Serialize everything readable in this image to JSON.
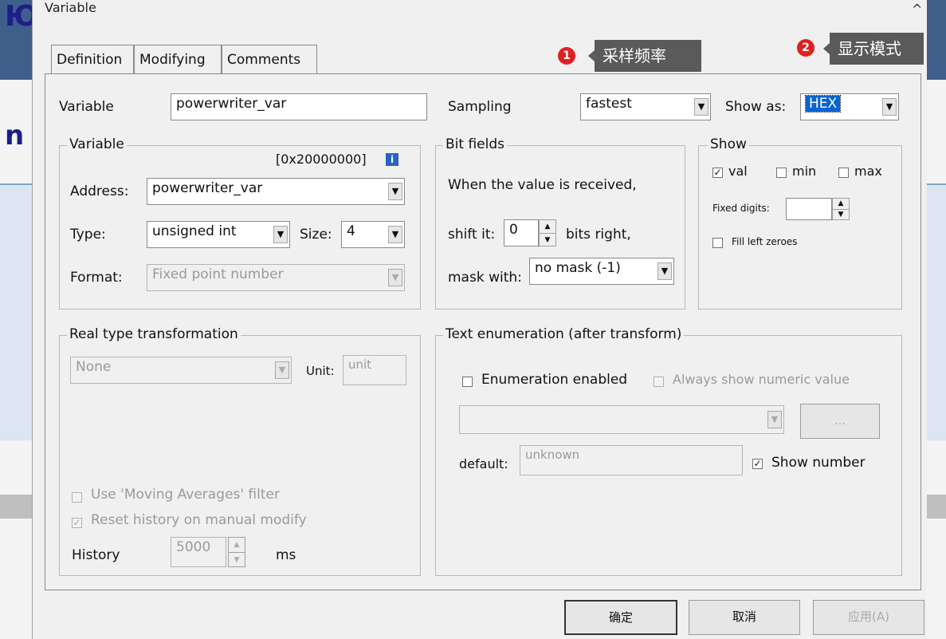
{
  "window": {
    "title": "Variable",
    "close_glyph": "^"
  },
  "tabs": [
    {
      "label": "Definition"
    },
    {
      "label": "Modifying"
    },
    {
      "label": "Comments"
    }
  ],
  "callouts": [
    {
      "badge": "1",
      "text": "采样频率"
    },
    {
      "badge": "2",
      "text": "显示模式"
    }
  ],
  "header": {
    "variable_label": "Variable",
    "variable_value": "powerwriter_var",
    "sampling_label": "Sampling",
    "sampling_value": "fastest",
    "show_as_label": "Show as:",
    "show_as_value": "HEX"
  },
  "variable_group": {
    "title": "Variable",
    "address_hex": "[0x20000000]",
    "info_glyph": "i",
    "address_label": "Address:",
    "address_value": "powerwriter_var",
    "type_label": "Type:",
    "type_value": "unsigned int",
    "size_label": "Size:",
    "size_value": "4",
    "format_label": "Format:",
    "format_value": "Fixed point number"
  },
  "bit_fields": {
    "title": "Bit fields",
    "when_text": "When the value is received,",
    "shift_label": "shift it:",
    "shift_value": "0",
    "bits_right": "bits right,",
    "mask_label": "mask with:",
    "mask_value": "no mask (-1)"
  },
  "show_group": {
    "title": "Show",
    "val_label": "val",
    "min_label": "min",
    "max_label": "max",
    "fixed_digits_label": "Fixed digits:",
    "fill_zeroes_label": "Fill left zeroes",
    "val_checked": true
  },
  "real_type": {
    "title": "Real type transformation",
    "value": "None",
    "unit_label": "Unit:",
    "unit_value": "unit",
    "moving_avg_label": "Use 'Moving Averages' filter",
    "reset_history_label": "Reset history on manual modify",
    "history_label": "History",
    "history_value": "5000",
    "history_unit": "ms"
  },
  "text_enum": {
    "title": "Text enumeration (after transform)",
    "enabled_label": "Enumeration enabled",
    "always_numeric_label": "Always show numeric value",
    "ellipsis_label": "...",
    "default_label": "default:",
    "default_value": "unknown",
    "show_number_label": "Show number"
  },
  "footer": {
    "ok": "确定",
    "cancel": "取消",
    "apply": "应用(A)"
  },
  "glyphs": {
    "check": "✓",
    "down": "▼",
    "up": "▲"
  },
  "colors": {
    "accent_badge": "#e02020",
    "callout_bg": "#5a5a5a",
    "selection": "#0a64d2"
  }
}
